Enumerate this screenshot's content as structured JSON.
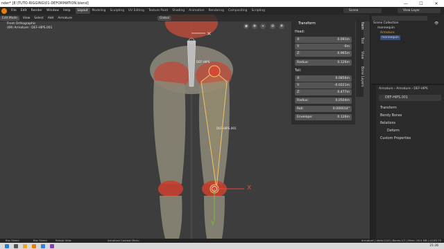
{
  "title_bar": {
    "text": "nder* [E:\\TUTO-RIGGING\\01-DEFORMATION.blend]"
  },
  "menu": {
    "items": [
      "File",
      "Edit",
      "Render",
      "Window",
      "Help"
    ],
    "workspaces": [
      "Layout",
      "Modeling",
      "Sculpting",
      "UV Editing",
      "Texture Paint",
      "Shading",
      "Animation",
      "Rendering",
      "Compositing",
      "Scripting"
    ],
    "scene": "Scene",
    "view_layer": "View Layer"
  },
  "viewport": {
    "header": {
      "mode": "Edit Mode",
      "menus": [
        "View",
        "Select",
        "Add",
        "Armature"
      ],
      "orientation": "Global"
    },
    "info_line1": "Front Orthographic",
    "info_line2": "(69) Armature : DEF-HIPS.001",
    "bone_label_top": "DEF-HIPS",
    "bone_label_mid": "DEF-HIPS.001",
    "axis_x": "X",
    "axis_y": "Y"
  },
  "npanel": {
    "title": "Transform",
    "head_label": "Head:",
    "head": [
      {
        "label": "X:",
        "value": "0.091m"
      },
      {
        "label": "Y:",
        "value": "-0m"
      },
      {
        "label": "Z:",
        "value": "0.965m"
      }
    ],
    "head_radius": {
      "label": "Radius:",
      "value": "0.126m"
    },
    "tail_label": "Tail:",
    "tail": [
      {
        "label": "X:",
        "value": "0.0856m"
      },
      {
        "label": "Y:",
        "value": "-0.0221m"
      },
      {
        "label": "Z:",
        "value": "0.477m"
      }
    ],
    "tail_radius": {
      "label": "Radius:",
      "value": "0.0504m"
    },
    "roll": {
      "label": "Roll:",
      "value": "0.000014°"
    },
    "envelope": {
      "label": "Envelope:",
      "value": "0.126m"
    },
    "tabs": [
      "Item",
      "Tool",
      "View",
      "Bone Layers"
    ]
  },
  "outliner": {
    "rows": [
      "Scene Collection",
      "mannequin",
      "Armature",
      "mannequin"
    ]
  },
  "properties": {
    "breadcrumb": [
      "Armature",
      "Armature",
      "DEF-HIPS"
    ],
    "bone_name": "DEF-HIPS.001",
    "panels": [
      "Transform",
      "Bendy Bones",
      "Relations",
      "Deform",
      "Custom Properties"
    ]
  },
  "status": {
    "items": [
      "Box Select",
      "Box Select",
      "Rotate View",
      "Armature Context Menu"
    ],
    "right": "Armature | Verts:2/10 | Bones:1/7 | Mem: 26.5 MB | v2.83.75"
  },
  "taskbar": {
    "time": "21:36"
  },
  "colors": {
    "accent_orange": "#e8a33a",
    "bone_highlight": "#f5c36a",
    "x_axis": "#e8473e",
    "y_axis": "#72c43a",
    "muscle_red": "#c7402e"
  }
}
